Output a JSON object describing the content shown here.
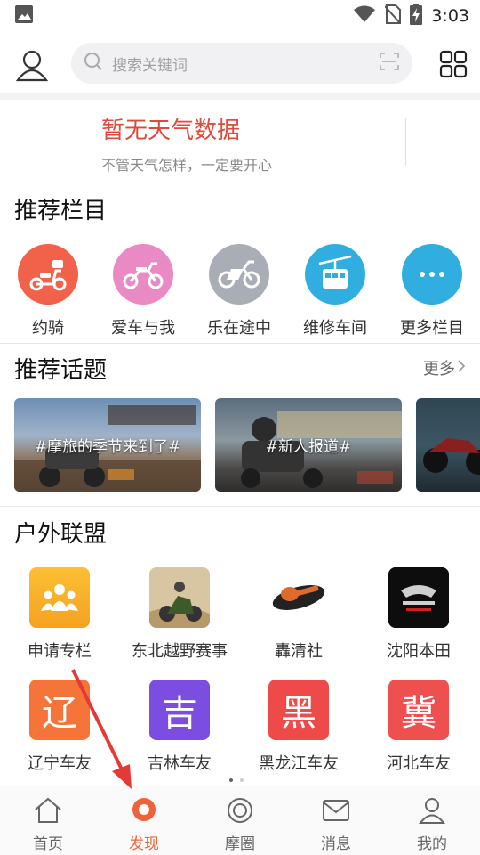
{
  "status_bar": {
    "time": "3:03"
  },
  "header": {
    "search_placeholder": "搜索关键词"
  },
  "weather": {
    "title": "暂无天气数据",
    "subtitle": "不管天气怎样，一定要开心"
  },
  "recommended_columns": {
    "title": "推荐栏目",
    "items": [
      {
        "label": "约骑",
        "icon": "scooter-icon",
        "color": "#f2614a"
      },
      {
        "label": "爱车与我",
        "icon": "dirt-bike-icon",
        "color": "#e98ac4"
      },
      {
        "label": "乐在途中",
        "icon": "motorcycle-icon",
        "color": "#a9aeb6"
      },
      {
        "label": "维修车间",
        "icon": "cable-car-icon",
        "color": "#31aee0"
      },
      {
        "label": "更多栏目",
        "icon": "more-icon",
        "color": "#31aee0"
      }
    ]
  },
  "recommended_topics": {
    "title": "推荐话题",
    "more_label": "更多",
    "items": [
      {
        "label": "#摩旅的季节来到了#"
      },
      {
        "label": "#新人报道#"
      },
      {
        "label": ""
      }
    ]
  },
  "outdoor_alliance": {
    "title": "户外联盟",
    "items": [
      {
        "label": "申请专栏",
        "icon": "group-icon",
        "color": "#f7b02a"
      },
      {
        "label": "东北越野赛事",
        "icon": "rally-photo-icon",
        "color": "#e9d7b8"
      },
      {
        "label": "轟清社",
        "icon": "hong-qing-she-logo",
        "color": "#ffffff"
      },
      {
        "label": "沈阳本田",
        "icon": "honda-wing-logo",
        "color": "#111111"
      },
      {
        "label": "辽宁车友",
        "glyph": "辽",
        "color": "#f4743a"
      },
      {
        "label": "吉林车友",
        "glyph": "吉",
        "color": "#7b4de0"
      },
      {
        "label": "黑龙江车友",
        "glyph": "黑",
        "color": "#ee4a4a"
      },
      {
        "label": "河北车友",
        "glyph": "冀",
        "color": "#ee5050"
      }
    ]
  },
  "tab_bar": {
    "items": [
      {
        "label": "首页",
        "icon": "home-icon",
        "active": false
      },
      {
        "label": "发现",
        "icon": "discover-icon",
        "active": true
      },
      {
        "label": "摩圈",
        "icon": "circle-icon",
        "active": false
      },
      {
        "label": "消息",
        "icon": "mail-icon",
        "active": false
      },
      {
        "label": "我的",
        "icon": "profile-icon",
        "active": false
      }
    ],
    "active_color": "#f0623a"
  }
}
